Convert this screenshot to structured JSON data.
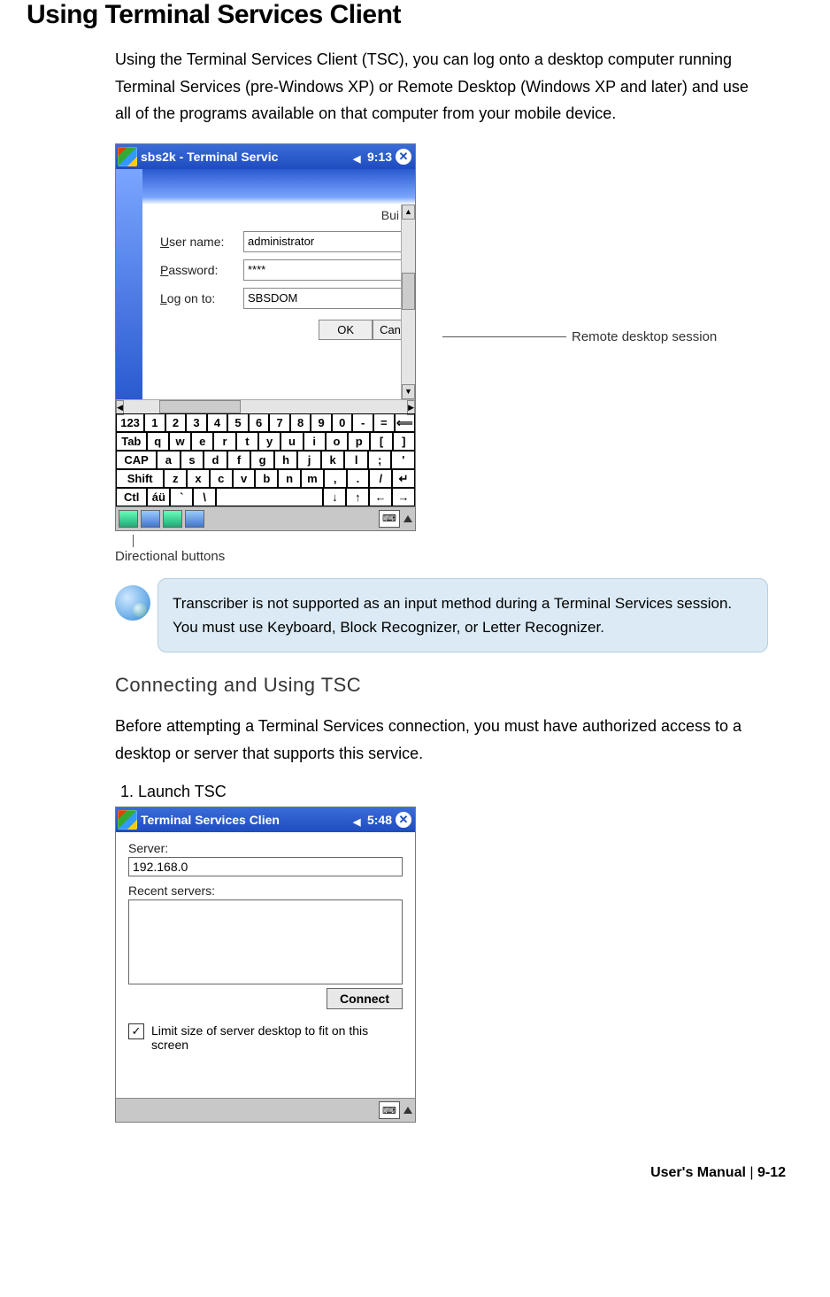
{
  "heading": "Using Terminal Services Client",
  "intro": "Using the Terminal Services Client (TSC), you can log onto a desktop computer running Terminal Services (pre-Windows XP) or Remote Desktop (Windows XP and later) and use all of the programs available on that computer from your mobile device.",
  "screenshot1": {
    "title": "sbs2k - Terminal Servic",
    "time": "9:13",
    "bui_text": "Bui",
    "username_label": "User name:",
    "username_value": "administrator",
    "password_label": "Password:",
    "password_value": "****",
    "logon_label": "Log on to:",
    "logon_value": "SBSDOM",
    "ok": "OK",
    "can": "Can",
    "keyboard_rows": [
      [
        "123",
        "1",
        "2",
        "3",
        "4",
        "5",
        "6",
        "7",
        "8",
        "9",
        "0",
        "-",
        "=",
        "⟸"
      ],
      [
        "Tab",
        "q",
        "w",
        "e",
        "r",
        "t",
        "y",
        "u",
        "i",
        "o",
        "p",
        "[",
        "]"
      ],
      [
        "CAP",
        "a",
        "s",
        "d",
        "f",
        "g",
        "h",
        "j",
        "k",
        "l",
        ";",
        "'"
      ],
      [
        "Shift",
        "z",
        "x",
        "c",
        "v",
        "b",
        "n",
        "m",
        ",",
        ".",
        "/",
        "↵"
      ],
      [
        "Ctl",
        "áü",
        "`",
        "\\",
        " ",
        " ",
        " ",
        " ",
        "↓",
        "↑",
        "←",
        "→"
      ]
    ]
  },
  "callout_remote": "Remote desktop session",
  "callout_directional": "Directional buttons",
  "note_text": "Transcriber is not supported as an input method during a Terminal Services session.    You must use Keyboard, Block Recognizer, or Letter Recognizer.",
  "subheading": "Connecting and Using TSC",
  "sub_intro": "Before attempting a Terminal Services connection, you must have authorized access to a desktop or server that supports this service.",
  "step1": "Launch TSC",
  "screenshot2": {
    "title": "Terminal Services Clien",
    "time": "5:48",
    "server_label": "Server:",
    "server_value": "192.168.0",
    "recent_label": "Recent servers:",
    "connect": "Connect",
    "limit_label": "Limit size of server desktop to fit on this screen"
  },
  "footer_manual": "User's Manual",
  "footer_page": "9-12"
}
